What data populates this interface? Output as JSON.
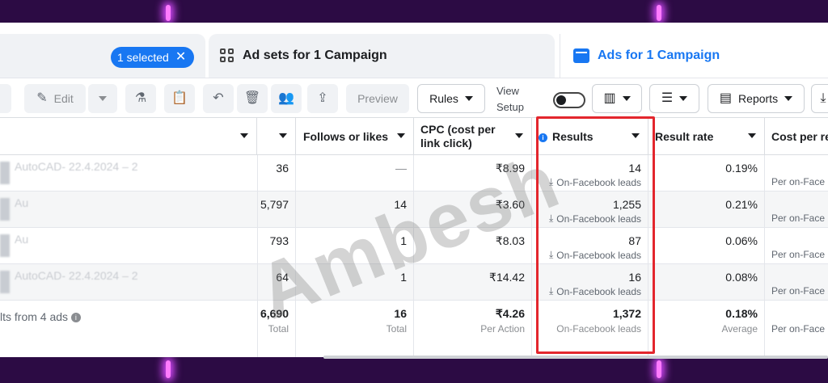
{
  "tabs": {
    "selected_label": "1 selected",
    "ad_sets_label": "Ad sets for 1 Campaign",
    "ads_label": "Ads for 1 Campaign"
  },
  "toolbar": {
    "edit_label": "Edit",
    "preview_label": "Preview",
    "rules_label": "Rules",
    "view_setup_line1": "View",
    "view_setup_line2": "Setup",
    "reports_label": "Reports"
  },
  "table": {
    "headers": {
      "follows": "Follows or likes",
      "cpc": "CPC (cost per link click)",
      "results": "Results",
      "result_rate": "Result rate",
      "cost_per": "Cost per re"
    },
    "rows": [
      {
        "name": "AutoCAD- 22.4.2024 – 2",
        "col1": "36",
        "follows": "—",
        "cpc": "₹8.99",
        "results": "14",
        "results_sub": "On-Facebook leads",
        "rate": "0.19%",
        "cost_sub": "Per on-Face"
      },
      {
        "name": "Au",
        "col1": "5,797",
        "follows": "14",
        "cpc": "₹3.60",
        "results": "1,255",
        "results_sub": "On-Facebook leads",
        "rate": "0.21%",
        "cost_sub": "Per on-Face"
      },
      {
        "name": "Au",
        "col1": "793",
        "follows": "1",
        "cpc": "₹8.03",
        "results": "87",
        "results_sub": "On-Facebook leads",
        "rate": "0.06%",
        "cost_sub": "Per on-Face"
      },
      {
        "name": "AutoCAD- 22.4.2024 – 2",
        "col1": "64",
        "follows": "1",
        "cpc": "₹14.42",
        "results": "16",
        "results_sub": "On-Facebook leads",
        "rate": "0.08%",
        "cost_sub": "Per on-Face"
      }
    ],
    "totals": {
      "label": "lts from 4 ads",
      "col1": "6,690",
      "col1_sub": "Total",
      "follows": "16",
      "follows_sub": "Total",
      "cpc": "₹4.26",
      "cpc_sub": "Per Action",
      "results": "1,372",
      "results_sub": "On-Facebook leads",
      "rate": "0.18%",
      "rate_sub": "Average",
      "cost_sub": "Per on-Face"
    }
  },
  "watermark": "Ambesh",
  "colors": {
    "accent": "#1877f2",
    "highlight": "#e3262d",
    "background": "#2c0b44"
  }
}
